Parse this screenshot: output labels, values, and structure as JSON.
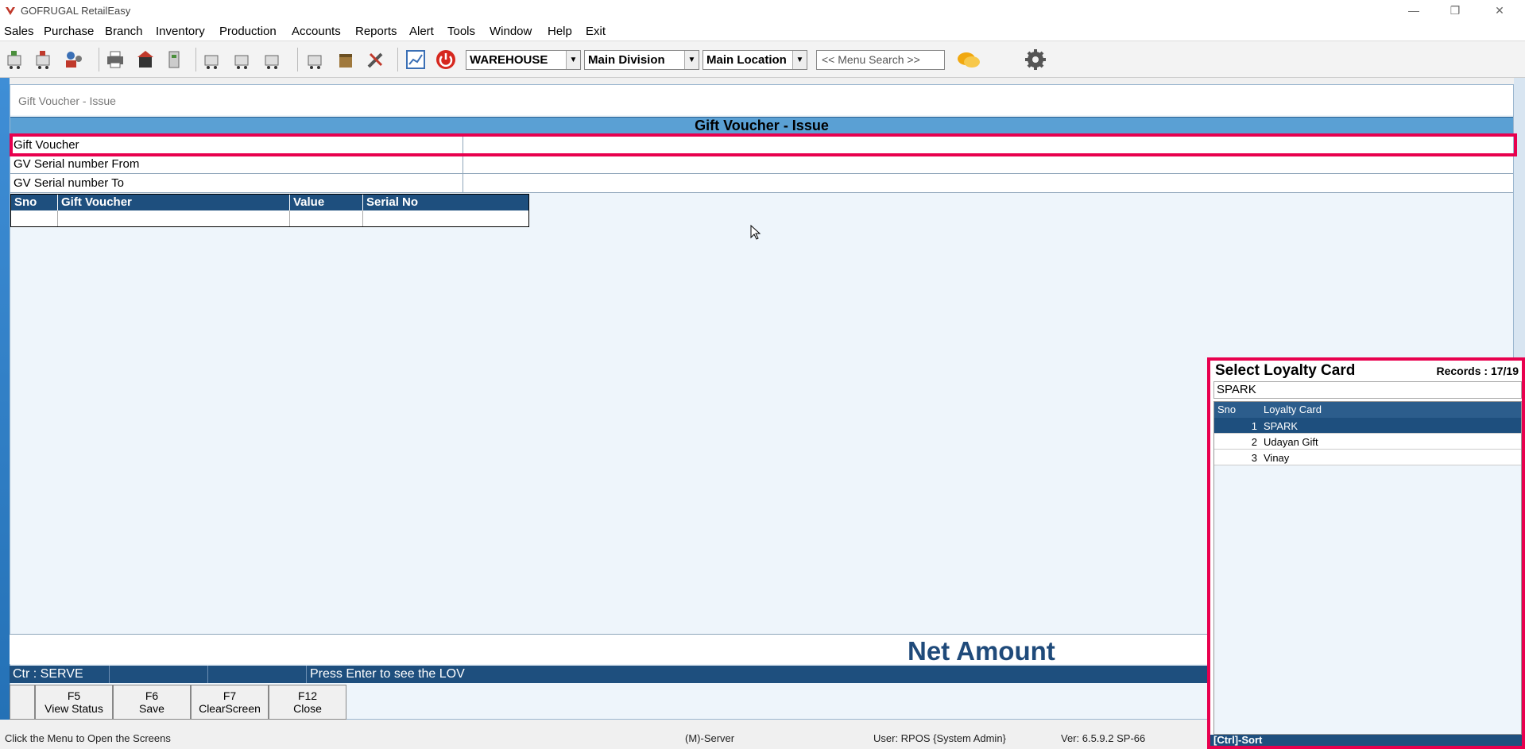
{
  "window": {
    "title": "GOFRUGAL RetailEasy"
  },
  "menu": [
    {
      "label": "Sales"
    },
    {
      "label": "Purchase"
    },
    {
      "label": "Branch"
    },
    {
      "label": "Inventory"
    },
    {
      "label": "Production"
    },
    {
      "label": "Accounts"
    },
    {
      "label": "Reports"
    },
    {
      "label": "Alert"
    },
    {
      "label": "Tools"
    },
    {
      "label": "Window"
    },
    {
      "label": "Help"
    },
    {
      "label": "Exit"
    }
  ],
  "toolbar": {
    "warehouse": "WAREHOUSE",
    "division": "Main Division",
    "location": "Main Location",
    "menu_search": "<< Menu Search >>"
  },
  "form": {
    "caption": "Gift Voucher - Issue",
    "header": "Gift Voucher - Issue",
    "fields": [
      {
        "label": "Gift Voucher",
        "value": ""
      },
      {
        "label": "GV Serial number From",
        "value": ""
      },
      {
        "label": "GV Serial number To",
        "value": ""
      }
    ],
    "table": {
      "columns": [
        "Sno",
        "Gift Voucher",
        "Value",
        "Serial No"
      ]
    },
    "net_amount_label": "Net Amount"
  },
  "status_strip": {
    "counter": "Ctr : SERVE",
    "message": "Press Enter to see the LOV"
  },
  "fkeys": [
    {
      "key": "",
      "label": ""
    },
    {
      "key": "F5",
      "label": "View Status"
    },
    {
      "key": "F6",
      "label": "Save"
    },
    {
      "key": "F7",
      "label": "ClearScreen"
    },
    {
      "key": "F12",
      "label": "Close"
    }
  ],
  "bottom_status": {
    "hint": "Click the Menu to Open the Screens",
    "server": "(M)-Server",
    "user": "User: RPOS {System Admin}",
    "version": "Ver: 6.5.9.2 SP-66"
  },
  "lov": {
    "title": "Select Loyalty Card",
    "records": "Records : 17/19",
    "search_value": "SPARK",
    "columns": [
      "Sno",
      "Loyalty Card"
    ],
    "rows": [
      {
        "sno": "1",
        "card": "SPARK",
        "selected": true
      },
      {
        "sno": "2",
        "card": "Udayan Gift",
        "selected": false
      },
      {
        "sno": "3",
        "card": "Vinay",
        "selected": false
      }
    ],
    "footer": "[Ctrl]-Sort"
  },
  "colors": {
    "accent_highlight": "#e8004e",
    "header_blue": "#1e4f7e",
    "form_header": "#5aa0d4"
  }
}
